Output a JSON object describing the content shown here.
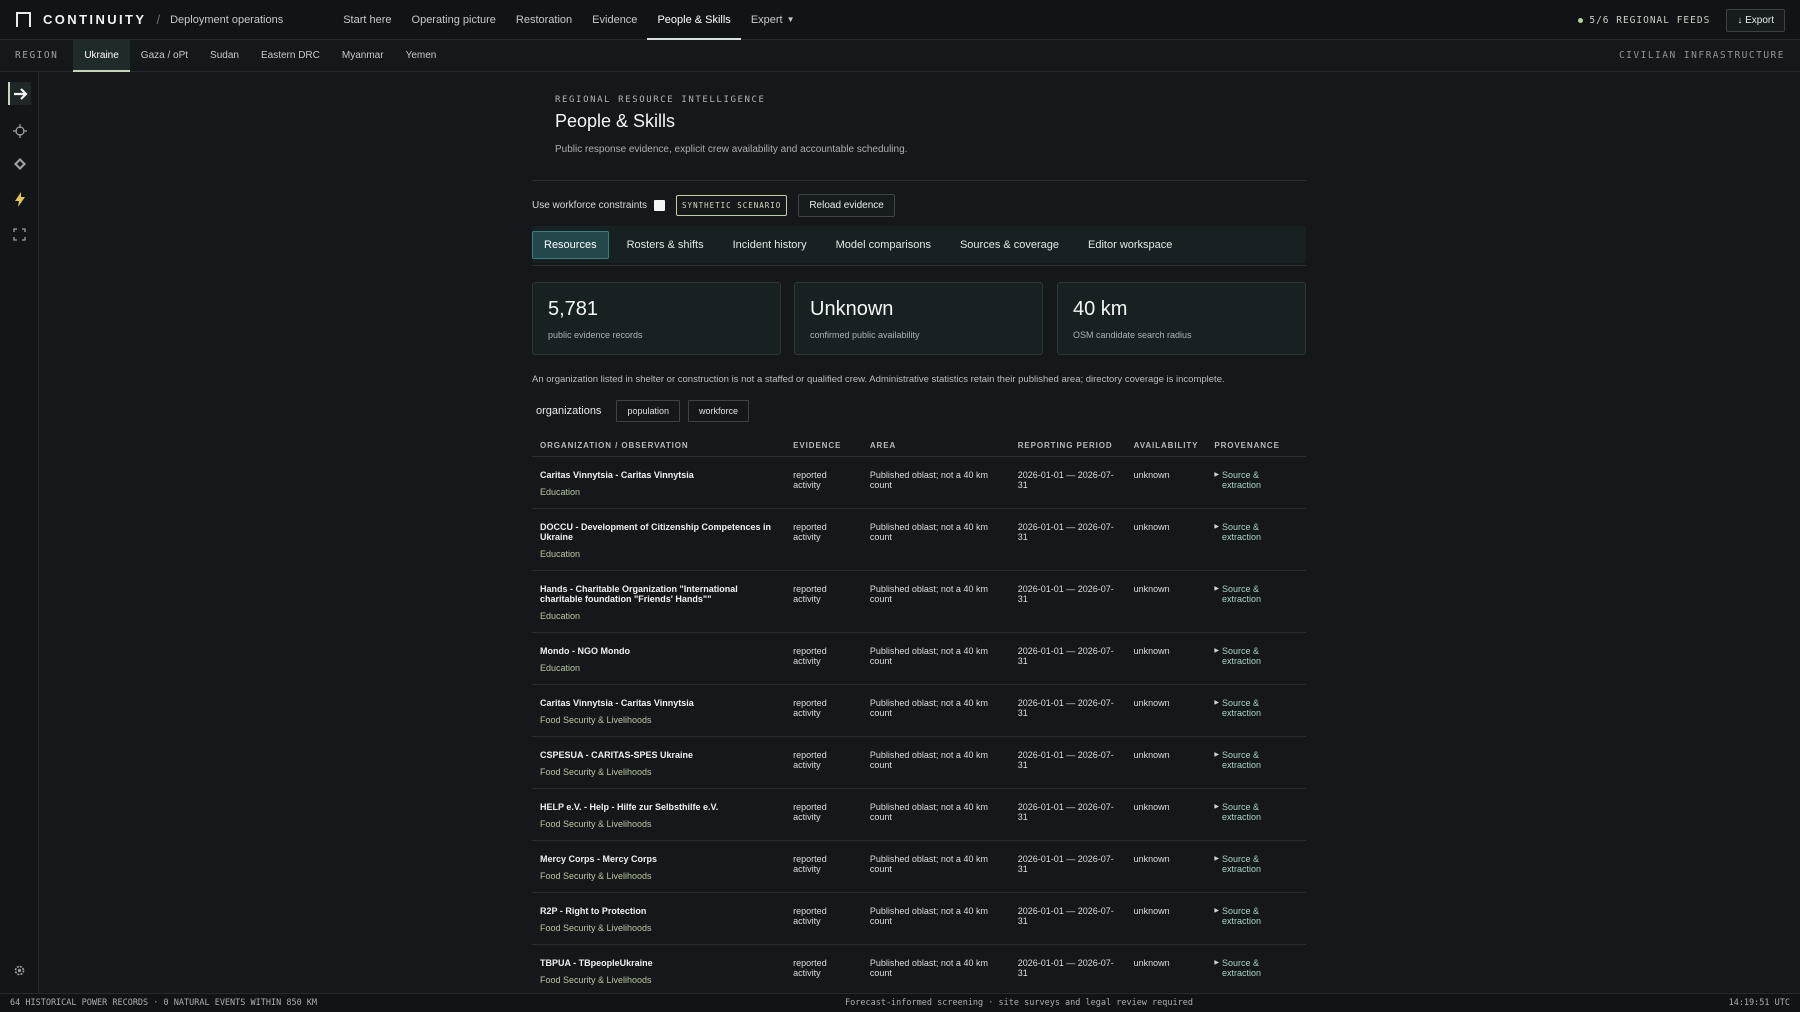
{
  "app": {
    "name": "CONTINUITY",
    "section": "Deployment operations"
  },
  "nav": {
    "items": [
      {
        "label": "Start here",
        "active": false
      },
      {
        "label": "Operating picture",
        "active": false
      },
      {
        "label": "Restoration",
        "active": false
      },
      {
        "label": "Evidence",
        "active": false
      },
      {
        "label": "People & Skills",
        "active": true
      },
      {
        "label": "Expert",
        "active": false
      }
    ],
    "feeds": "5/6 REGIONAL FEEDS",
    "export_label": "↓ Export"
  },
  "region": {
    "label": "REGION",
    "tabs": [
      "Ukraine",
      "Gaza / oPt",
      "Sudan",
      "Eastern DRC",
      "Myanmar",
      "Yemen"
    ],
    "active": "Ukraine",
    "domain_label": "CIVILIAN INFRASTRUCTURE"
  },
  "rail": {
    "icons": [
      "arrow-right-icon",
      "crosshair-icon",
      "diamond-icon",
      "bolt-icon",
      "expand-icon",
      "gear-icon"
    ]
  },
  "page": {
    "eyebrow": "REGIONAL RESOURCE INTELLIGENCE",
    "title": "People & Skills",
    "subtitle": "Public response evidence, explicit crew availability and accountable scheduling."
  },
  "controls": {
    "workforce_label": "Use workforce constraints",
    "workforce_checked": false,
    "synthetic_badge": "SYNTHETIC SCENARIO",
    "reload_label": "Reload evidence"
  },
  "tabs": [
    "Resources",
    "Rosters & shifts",
    "Incident history",
    "Model comparisons",
    "Sources & coverage",
    "Editor workspace"
  ],
  "active_tab": "Resources",
  "stats": [
    {
      "value": "5,781",
      "label": "public evidence records"
    },
    {
      "value": "Unknown",
      "label": "confirmed public availability"
    },
    {
      "value": "40 km",
      "label": "OSM candidate search radius"
    }
  ],
  "note": "An organization listed in shelter or construction is not a staffed or qualified crew. Administrative statistics retain their published area; directory coverage is incomplete.",
  "filters": {
    "label": "organizations",
    "chips": [
      "population",
      "workforce"
    ]
  },
  "table": {
    "headers": [
      "ORGANIZATION / OBSERVATION",
      "EVIDENCE",
      "AREA",
      "REPORTING PERIOD",
      "AVAILABILITY",
      "PROVENANCE"
    ],
    "rows": [
      {
        "org": "Caritas Vinnytsia - Caritas Vinnytsia",
        "sector": "Education",
        "evidence": "reported activity",
        "area": "Published oblast; not a 40 km count",
        "period": "2026-01-01 — 2026-07-31",
        "availability": "unknown",
        "provenance": "Source & extraction"
      },
      {
        "org": "DOCCU - Development of Citizenship Competences in Ukraine",
        "sector": "Education",
        "evidence": "reported activity",
        "area": "Published oblast; not a 40 km count",
        "period": "2026-01-01 — 2026-07-31",
        "availability": "unknown",
        "provenance": "Source & extraction"
      },
      {
        "org": "Hands - Charitable Organization \"International charitable foundation \"Friends' Hands\"\"",
        "sector": "Education",
        "evidence": "reported activity",
        "area": "Published oblast; not a 40 km count",
        "period": "2026-01-01 — 2026-07-31",
        "availability": "unknown",
        "provenance": "Source & extraction"
      },
      {
        "org": "Mondo - NGO Mondo",
        "sector": "Education",
        "evidence": "reported activity",
        "area": "Published oblast; not a 40 km count",
        "period": "2026-01-01 — 2026-07-31",
        "availability": "unknown",
        "provenance": "Source & extraction"
      },
      {
        "org": "Caritas Vinnytsia - Caritas Vinnytsia",
        "sector": "Food Security & Livelihoods",
        "evidence": "reported activity",
        "area": "Published oblast; not a 40 km count",
        "period": "2026-01-01 — 2026-07-31",
        "availability": "unknown",
        "provenance": "Source & extraction"
      },
      {
        "org": "CSPESUA - CARITAS-SPES Ukraine",
        "sector": "Food Security & Livelihoods",
        "evidence": "reported activity",
        "area": "Published oblast; not a 40 km count",
        "period": "2026-01-01 — 2026-07-31",
        "availability": "unknown",
        "provenance": "Source & extraction"
      },
      {
        "org": "HELP e.V. - Help - Hilfe zur Selbsthilfe e.V.",
        "sector": "Food Security & Livelihoods",
        "evidence": "reported activity",
        "area": "Published oblast; not a 40 km count",
        "period": "2026-01-01 — 2026-07-31",
        "availability": "unknown",
        "provenance": "Source & extraction"
      },
      {
        "org": "Mercy Corps - Mercy Corps",
        "sector": "Food Security & Livelihoods",
        "evidence": "reported activity",
        "area": "Published oblast; not a 40 km count",
        "period": "2026-01-01 — 2026-07-31",
        "availability": "unknown",
        "provenance": "Source & extraction"
      },
      {
        "org": "R2P - Right to Protection",
        "sector": "Food Security & Livelihoods",
        "evidence": "reported activity",
        "area": "Published oblast; not a 40 km count",
        "period": "2026-01-01 — 2026-07-31",
        "availability": "unknown",
        "provenance": "Source & extraction"
      },
      {
        "org": "TBPUA - TBpeopleUkraine",
        "sector": "Food Security & Livelihoods",
        "evidence": "reported activity",
        "area": "Published oblast; not a 40 km count",
        "period": "2026-01-01 — 2026-07-31",
        "availability": "unknown",
        "provenance": "Source & extraction"
      }
    ]
  },
  "footer": {
    "left": "64 HISTORICAL POWER RECORDS · 0 NATURAL EVENTS WITHIN 850 KM",
    "center": "Forecast-informed screening · site surveys and legal review required",
    "right": "14:19:51 UTC"
  }
}
